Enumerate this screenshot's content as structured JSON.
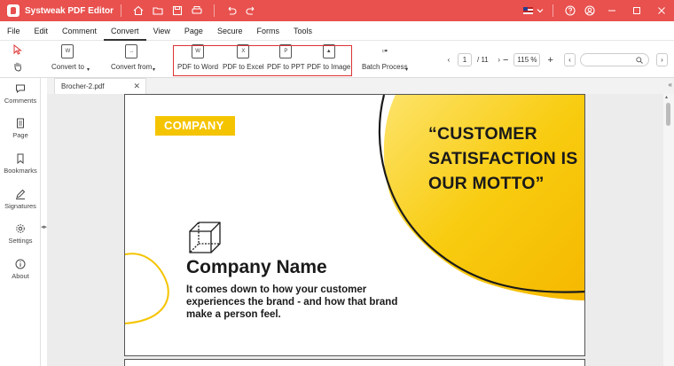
{
  "app": {
    "title": "Systweak PDF Editor",
    "accent": "#e8514e"
  },
  "titlebar_icons": [
    "home-icon",
    "folder-icon",
    "save-icon",
    "print-icon",
    "undo-icon",
    "redo-icon"
  ],
  "window_controls": [
    "flag-icon",
    "language-dropdown",
    "help-icon",
    "user-icon",
    "minimize",
    "maximize",
    "close"
  ],
  "menu": [
    "File",
    "Edit",
    "Comment",
    "Convert",
    "View",
    "Page",
    "Secure",
    "Forms",
    "Tools"
  ],
  "menu_active": "Convert",
  "ribbon": {
    "convert_to": "Convert to",
    "convert_from": "Convert from",
    "pdf_to_word": "PDF to Word",
    "pdf_to_excel": "PDF to Excel",
    "pdf_to_ppt": "PDF to PPT",
    "pdf_to_image": "PDF to Image",
    "batch_process": "Batch Process",
    "page_current": "1",
    "page_total": "/ 11",
    "zoom": "115 %"
  },
  "sidebar": {
    "comments": "Comments",
    "page": "Page",
    "bookmarks": "Bookmarks",
    "signatures": "Signatures",
    "settings": "Settings",
    "about": "About"
  },
  "tab": {
    "filename": "Brocher-2.pdf"
  },
  "document": {
    "company_tag": "COMPANY",
    "quote_line1": "“CUSTOMER",
    "quote_line2": "SATISFACTION IS",
    "quote_line3": "OUR MOTTO”",
    "company_name": "Company Name",
    "desc_line1": "It comes down to how your customer",
    "desc_line2": "experiences the brand - and how that brand",
    "desc_line3": "make a person feel.",
    "yellow": "#f5c400"
  }
}
